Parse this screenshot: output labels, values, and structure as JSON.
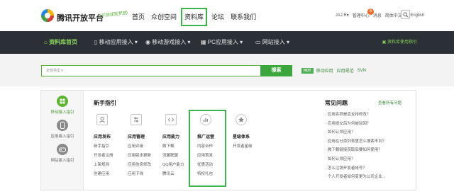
{
  "colors": {
    "accent": "#3bb54a",
    "dark_nav": "#2b3036",
    "badge": "#f26b24"
  },
  "header": {
    "brand": "腾讯开放平台",
    "slogan": "(开放成就梦想)",
    "nav": [
      "首页",
      "众创空间",
      "资料库",
      "论坛",
      "联系我们"
    ],
    "active_nav": "资料库",
    "links": {
      "user": "JAJ R▾",
      "manage": "管理中心",
      "messages": "消息",
      "messages_count": "6",
      "lang_cn": "简体中文",
      "lang_en": "English"
    },
    "search_icon": "search-icon"
  },
  "dark_nav": {
    "home": "资料库首页",
    "items": [
      "移动应用接入",
      "移动游戏接入",
      "PC应用接入",
      "网站接入"
    ],
    "right_link": "资料库使用指引"
  },
  "search": {
    "category_placeholder": "全部类型",
    "button": "搜索",
    "hot_tag": "HOT",
    "hot_links": [
      "移动应用",
      "应用规范",
      "SVN"
    ]
  },
  "sidebar": {
    "items": [
      {
        "label": "移动接入指引",
        "icon": "grid-icon",
        "active": true
      },
      {
        "label": "应用接入指引",
        "icon": "phone-icon",
        "active": false
      },
      {
        "label": "网站接入指引",
        "icon": "gamepad-icon",
        "active": false
      }
    ]
  },
  "guide": {
    "title": "新手指引",
    "columns": [
      {
        "title": "应用发布",
        "icon": "user-icon",
        "links": [
          "新手指引",
          "开发者注册",
          "上架规则",
          "创建应用"
        ]
      },
      {
        "title": "应用管理",
        "icon": "settings-icon",
        "links": [
          "应用评级",
          "应用版本更新",
          "应用信息修改",
          "应用下线"
        ]
      },
      {
        "title": "应用能力",
        "icon": "code-icon",
        "links": [
          "微下载",
          "流量联盟",
          "QQ用户能力",
          "腾讯云"
        ]
      },
      {
        "title": "推广运营",
        "icon": "chart-icon",
        "links": [
          "内容合作",
          "应用首发",
          "优惠活动",
          "特权礼包"
        ]
      },
      {
        "title": "星级体系",
        "icon": "star-icon",
        "links": [
          "开发者星级"
        ]
      }
    ]
  },
  "faq": {
    "title": "常见问题",
    "all_link": "查看所有问题",
    "items": [
      "应用名称是否支持修改？",
      "应用提交后为何被驳回？",
      "如何认领应用？",
      "应用在分类列表里怎么搜索不到？",
      "微下载链接获取后要如何使用？",
      "如何认领应用？",
      "怎么注销开发者帐号？",
      "个人开发者如何变更为公司企业..."
    ]
  }
}
